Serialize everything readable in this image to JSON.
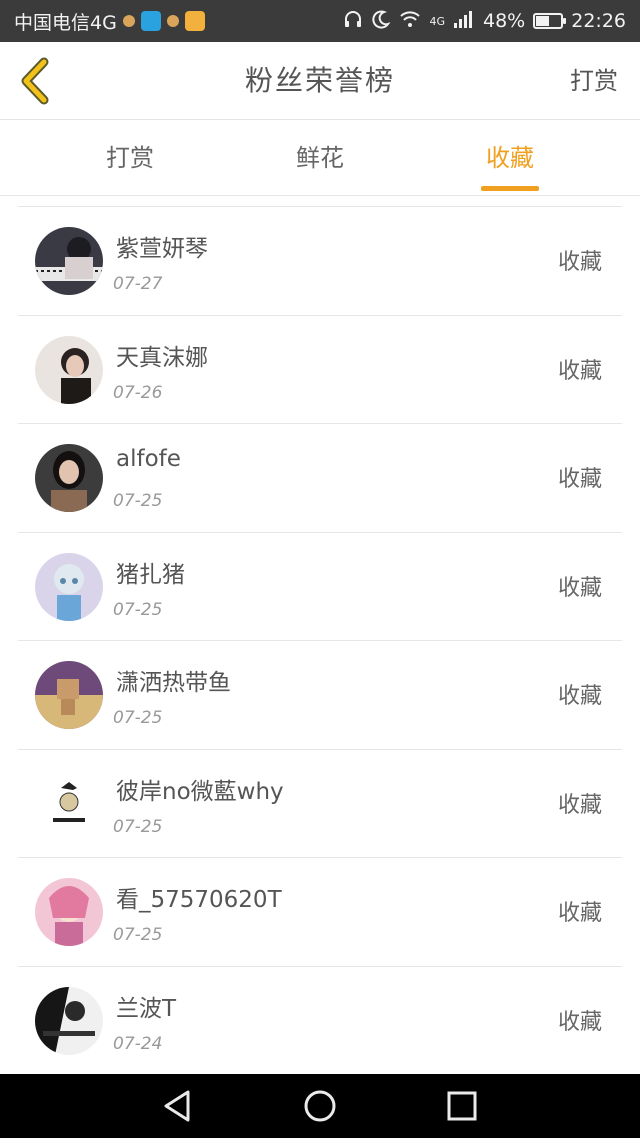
{
  "status_bar": {
    "carrier": "中国电信4G",
    "network": "4G",
    "battery": "48%",
    "battery_level": 0.48,
    "time": "22:26"
  },
  "header": {
    "title": "粉丝荣誉榜",
    "right_action": "打赏"
  },
  "tabs": [
    {
      "label": "打赏",
      "active": false
    },
    {
      "label": "鲜花",
      "active": false
    },
    {
      "label": "收藏",
      "active": true
    }
  ],
  "accent_color": "#f0a020",
  "rows": [
    {
      "name": "紫萱妍琴",
      "date": "07-27",
      "action": "收藏"
    },
    {
      "name": "天真沫娜",
      "date": "07-26",
      "action": "收藏"
    },
    {
      "name": "alfofe",
      "date": "07-25",
      "action": "收藏"
    },
    {
      "name": "猪扎猪",
      "date": "07-25",
      "action": "收藏"
    },
    {
      "name": "潇洒热带鱼",
      "date": "07-25",
      "action": "收藏"
    },
    {
      "name": "彼岸no微藍why",
      "date": "07-25",
      "action": "收藏"
    },
    {
      "name": "看_57570620T",
      "date": "07-25",
      "action": "收藏"
    },
    {
      "name": "兰波T",
      "date": "07-24",
      "action": "收藏"
    }
  ]
}
